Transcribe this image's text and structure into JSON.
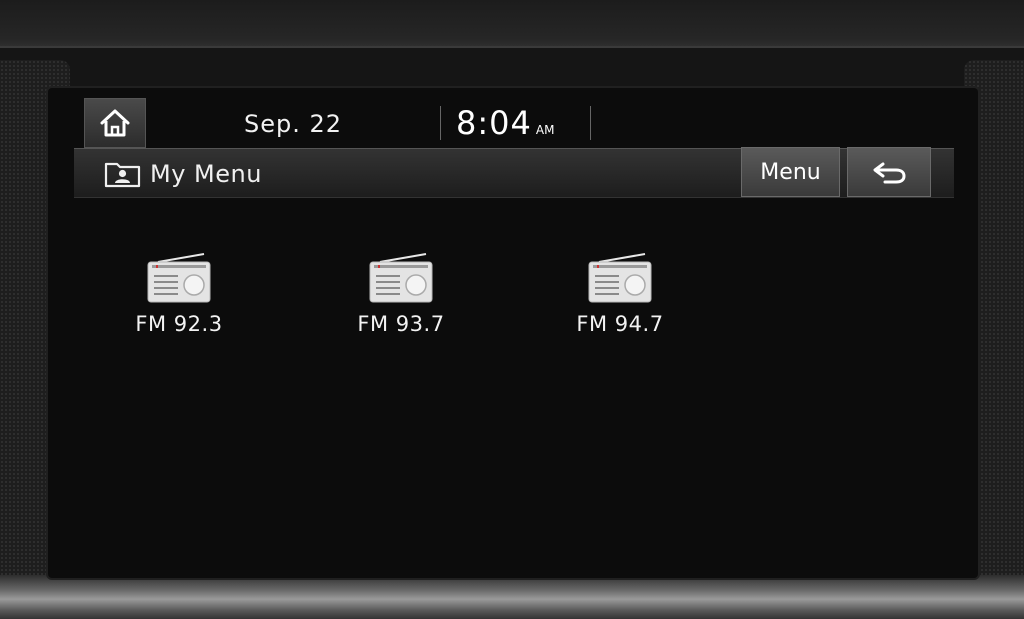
{
  "status": {
    "date": "Sep. 22",
    "time": "8:04",
    "ampm": "AM"
  },
  "header": {
    "title": "My Menu",
    "menu_label": "Menu"
  },
  "favorites": [
    {
      "label": "FM 92.3",
      "icon": "radio-icon"
    },
    {
      "label": "FM 93.7",
      "icon": "radio-icon"
    },
    {
      "label": "FM 94.7",
      "icon": "radio-icon"
    }
  ],
  "colors": {
    "screen_bg": "#0c0c0c",
    "text": "#f2f2f2",
    "button": "#4a4a4a"
  }
}
